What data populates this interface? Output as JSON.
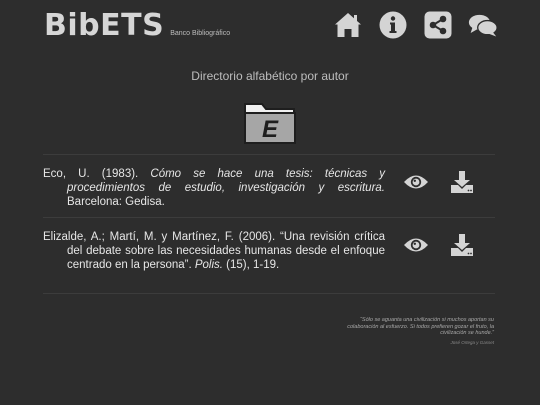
{
  "header": {
    "logo_main": "BibETS",
    "logo_sub": "Banco Bibliográfico",
    "nav": [
      "home-icon",
      "info-icon",
      "share-icon",
      "comments-icon"
    ]
  },
  "main": {
    "section_title": "Directorio alfabético por autor",
    "folder_letter": "E",
    "entries": [
      {
        "authors": "Eco, U. (1983). ",
        "title": "Cómo se hace una tesis: técnicas y procedimientos de estudio, investigación y escritura.",
        "rest": " Barcelona: Gedisa.",
        "actions": [
          "eye-icon",
          "download-icon"
        ]
      },
      {
        "authors": "Elizalde, A.; Martí, M. y Martínez, F. (2006). “Una revisión crítica del debate sobre las necesidades humanas desde el enfoque centrado en la persona”. ",
        "title": "Polis.",
        "rest": " (15), 1-19.",
        "actions": [
          "eye-icon",
          "download-icon"
        ]
      }
    ]
  },
  "footer": {
    "quote": "“Sólo se aguanta una civilización si muchos aportan su colaboración al esfuerzo. Si todos prefieren gozar el fruto, la civilización se hunde.”",
    "quote_author": "José Ortega y Gasset"
  },
  "colors": {
    "background": "#2d2d2d",
    "text": "#e6e6e6",
    "icon": "#d4d4d4"
  }
}
